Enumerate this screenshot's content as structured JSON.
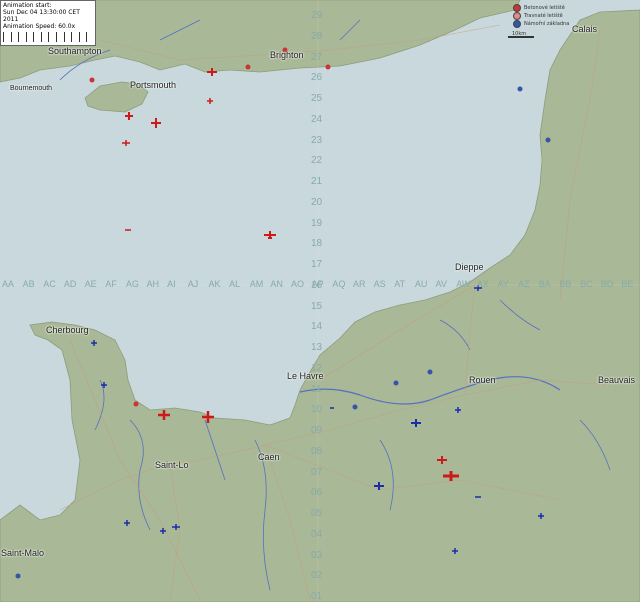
{
  "info": {
    "line1": "Animation start:",
    "line2": "Sun Dec 04 13:30:00 CET 2011",
    "line3": "Animation Speed: 60.0x"
  },
  "legend": {
    "items": [
      {
        "label": "Betonové letiště",
        "color": "#cc3333"
      },
      {
        "label": "Travnaté letiště",
        "color": "#cc3333"
      },
      {
        "label": "Námořní základna",
        "color": "#3355aa"
      }
    ]
  },
  "scale": {
    "label": "10km"
  },
  "cities": [
    {
      "name": "Southampton"
    },
    {
      "name": "Brighton"
    },
    {
      "name": "Calais"
    },
    {
      "name": "Portsmouth"
    },
    {
      "name": "Bournemouth"
    },
    {
      "name": "Dieppe"
    },
    {
      "name": "Cherbourg"
    },
    {
      "name": "Le Havre"
    },
    {
      "name": "Rouen"
    },
    {
      "name": "Beauvais"
    },
    {
      "name": "Caen"
    },
    {
      "name": "Saint-Lo"
    },
    {
      "name": "Saint-Malo"
    }
  ],
  "grid": {
    "columns": [
      "AA",
      "AB",
      "AC",
      "AD",
      "AE",
      "AF",
      "AG",
      "AH",
      "AI",
      "AJ",
      "AK",
      "AL",
      "AM",
      "AN",
      "AO",
      "AP",
      "AQ",
      "AR",
      "AS",
      "AT",
      "AU",
      "AV",
      "AW",
      "AX",
      "AY",
      "AZ",
      "BA",
      "BB",
      "BC",
      "BD",
      "BE"
    ],
    "rows": [
      "29",
      "28",
      "27",
      "26",
      "25",
      "24",
      "23",
      "22",
      "21",
      "20",
      "19",
      "18",
      "17",
      "16",
      "15",
      "14",
      "13",
      "12",
      "11",
      "10",
      "09",
      "08",
      "07",
      "06",
      "05",
      "04",
      "03",
      "02",
      "01"
    ]
  },
  "colors": {
    "sea": "#c9d8dc",
    "land": "#a7b795",
    "allied": "#cc1a1a",
    "axis": "#1b2ea8"
  },
  "aircraft": {
    "red_count": 14,
    "blue_count": 20
  }
}
